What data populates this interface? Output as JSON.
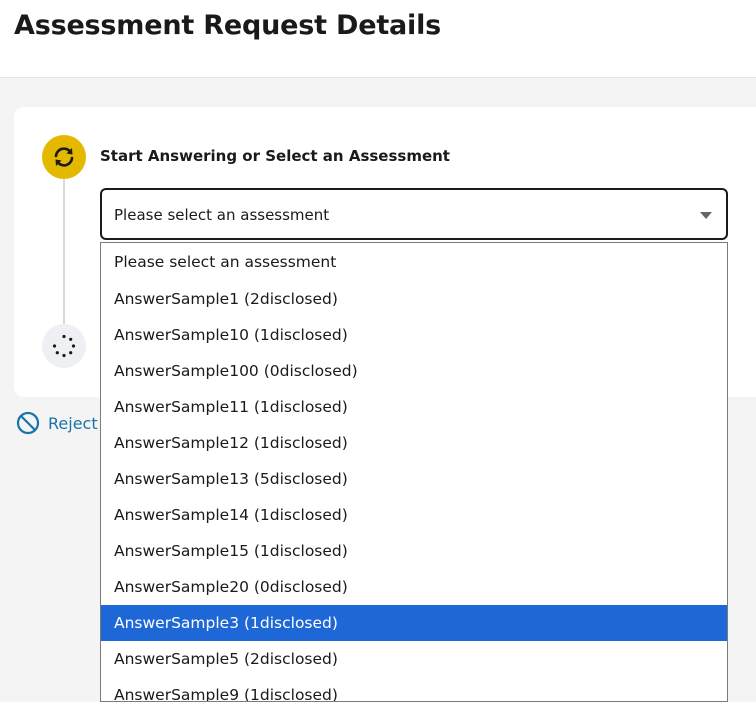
{
  "page": {
    "title": "Assessment Request Details"
  },
  "step1": {
    "title": "Start Answering or Select an Assessment"
  },
  "select": {
    "value": "Please select an assessment"
  },
  "reject": {
    "label": "Reject R"
  },
  "dropdown": {
    "options": [
      "Please select an assessment",
      "AnswerSample1 (2disclosed)",
      "AnswerSample10 (1disclosed)",
      "AnswerSample100 (0disclosed)",
      "AnswerSample11 (1disclosed)",
      "AnswerSample12 (1disclosed)",
      "AnswerSample13 (5disclosed)",
      "AnswerSample14 (1disclosed)",
      "AnswerSample15 (1disclosed)",
      "AnswerSample20 (0disclosed)",
      "AnswerSample3 (1disclosed)",
      "AnswerSample5 (2disclosed)",
      "AnswerSample9 (1disclosed)"
    ],
    "selected": "AnswerSample3 (1disclosed)"
  },
  "colors": {
    "step_active": "#e5b800",
    "highlight": "#1e67d6",
    "link": "#1a73a8"
  },
  "icons": {
    "step1": "sync-icon",
    "step2": "loading-spinner-icon",
    "reject": "prohibited-icon",
    "select": "chevron-down-icon"
  }
}
